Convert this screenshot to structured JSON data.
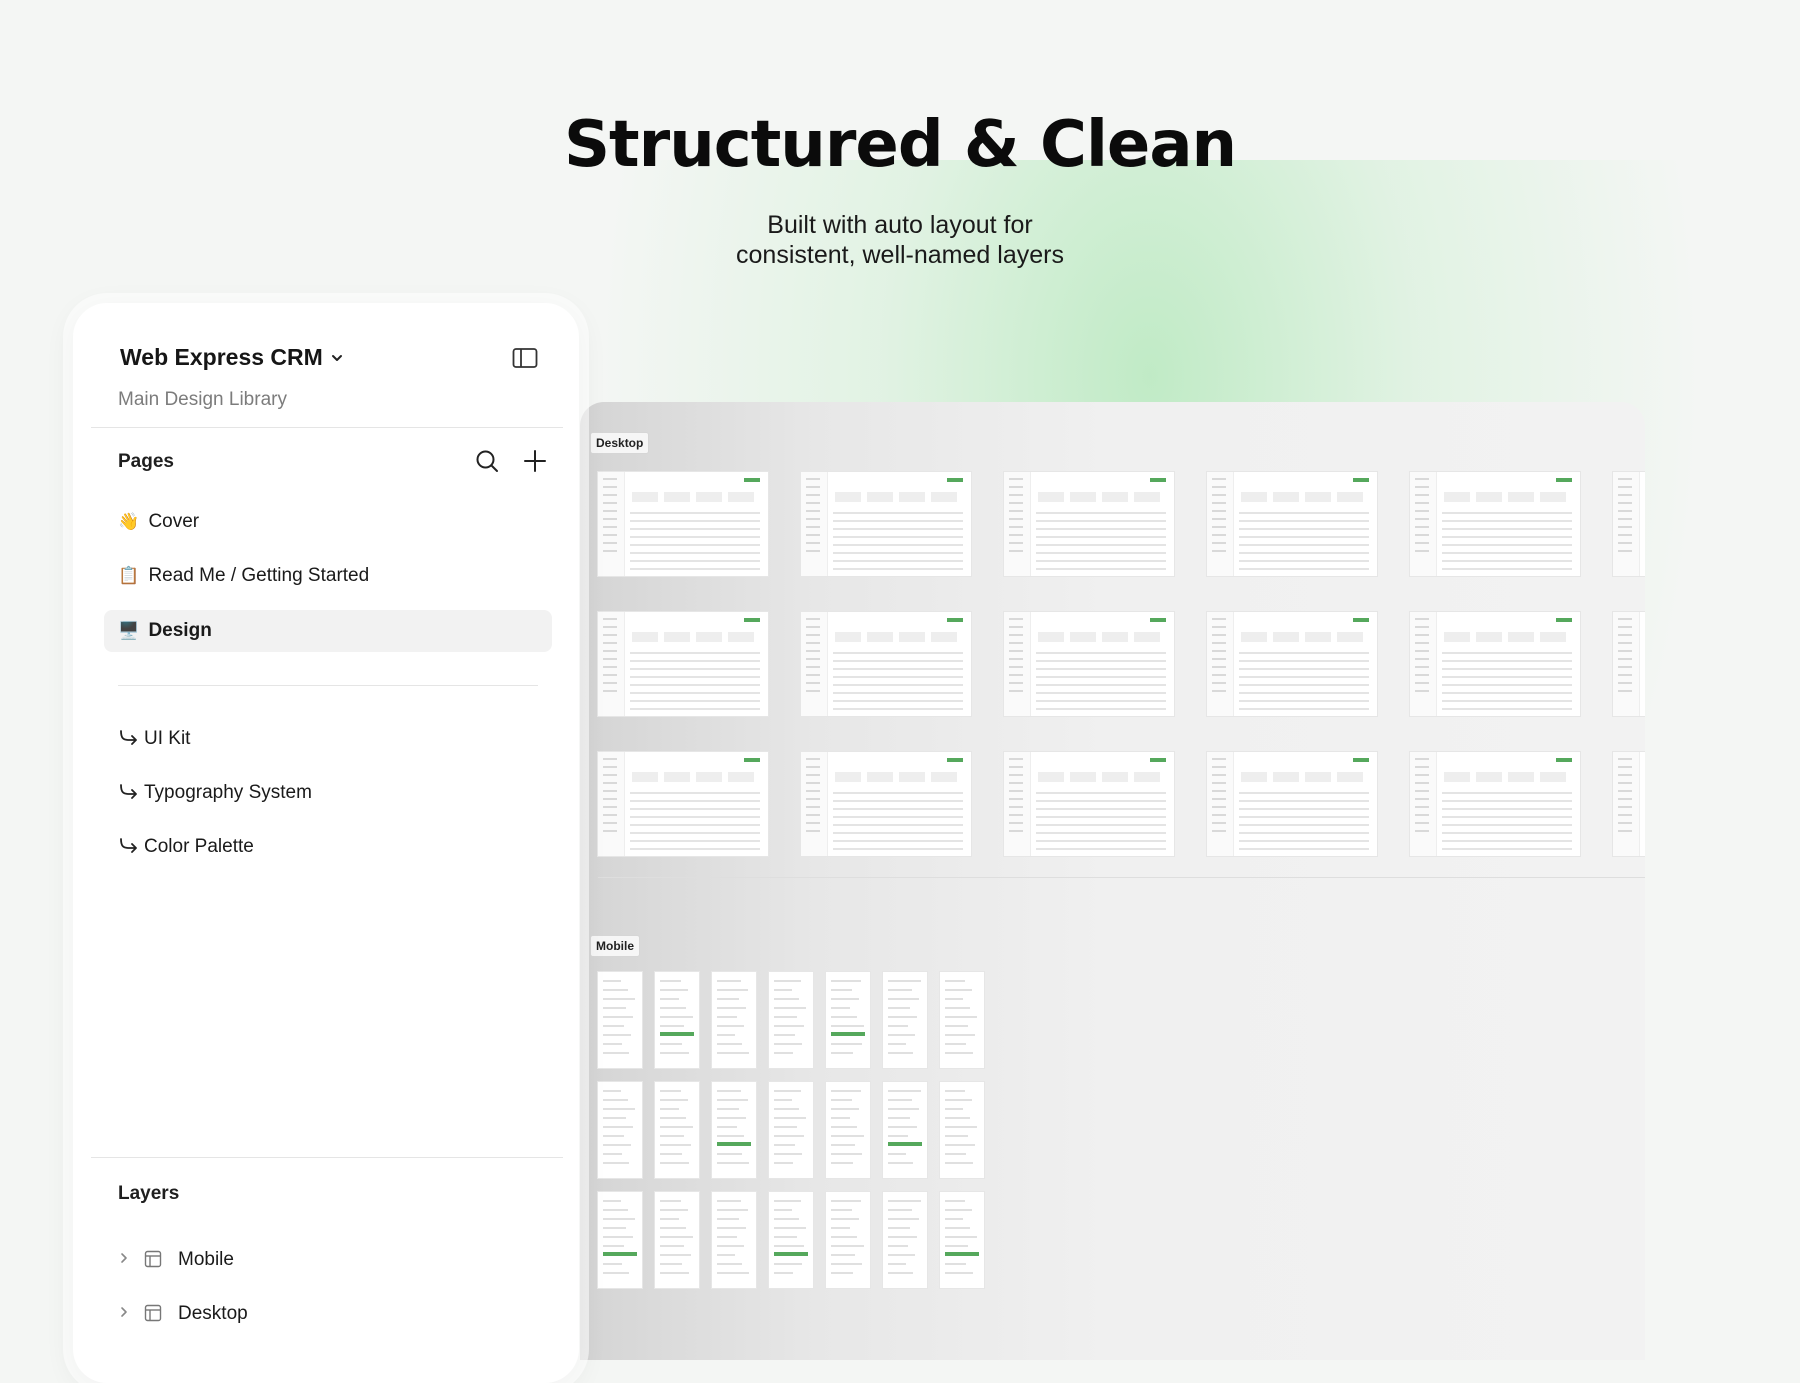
{
  "hero": {
    "title": "Structured & Clean",
    "subtitle_line1": "Built with auto layout for",
    "subtitle_line2": "consistent, well-named layers"
  },
  "panel": {
    "file_title": "Web Express CRM",
    "file_subtitle": "Main Design Library",
    "pages_title": "Pages",
    "pages": [
      {
        "emoji": "👋",
        "label": "Cover",
        "active": false
      },
      {
        "emoji": "📋",
        "label": "Read Me / Getting Started",
        "active": false
      },
      {
        "emoji": "🖥️",
        "label": "Design",
        "active": true
      }
    ],
    "links": [
      {
        "label": "UI Kit"
      },
      {
        "label": "Typography System"
      },
      {
        "label": "Color Palette"
      }
    ],
    "layers_title": "Layers",
    "layers": [
      {
        "label": "Mobile"
      },
      {
        "label": "Desktop"
      }
    ]
  },
  "canvas": {
    "desktop_label": "Desktop",
    "mobile_label": "Mobile"
  },
  "colors": {
    "accent_green": "#55a85c",
    "glow_green": "#9ee3a8"
  },
  "icons": [
    "chevron-down-icon",
    "sidebar-toggle-icon",
    "search-icon",
    "plus-icon",
    "link-arrow-icon",
    "caret-right-icon",
    "frame-icon"
  ]
}
